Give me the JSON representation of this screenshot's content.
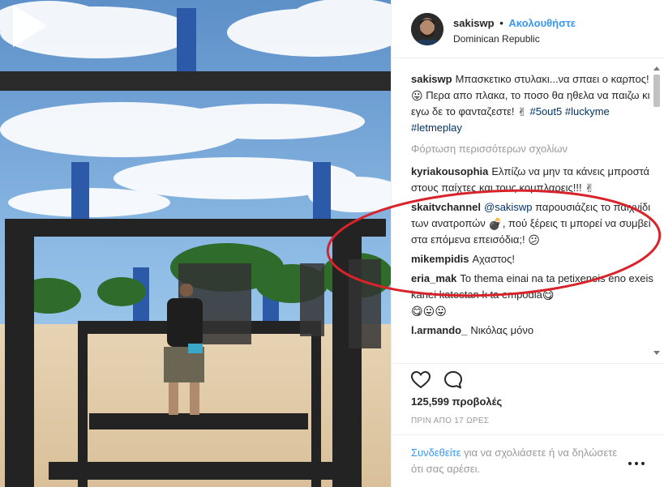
{
  "post": {
    "username": "sakiswp",
    "separator": "•",
    "follow_label": "Ακολουθήστε",
    "location": "Dominican Republic"
  },
  "caption": {
    "username": "sakiswp",
    "text": "Μπασκετικο στυλακι...να σπαει ο καρπος!",
    "text2": "Περα απο πλακα, το ποσο θα ηθελα να παιζω κι εγω δε το φανταζεστε!",
    "hashtags": [
      "#5out5",
      "#luckyme",
      "#letmeplay"
    ],
    "emojis": [
      "😛",
      "✌"
    ]
  },
  "load_more_label": "Φόρτωση περισσότερων σχολίων",
  "comments": [
    {
      "username": "kyriakousophia",
      "text": "Ελπίζω να μην τα κάνεις μπροστά στους παίχτες και τους κομπλαρεις!!!",
      "emoji": "✌"
    },
    {
      "username": "skaitvchannel",
      "mention": "@sakiswp",
      "text": "παρουσιάζεις το παιχνίδι των ανατροπών",
      "emoji": "💣",
      "text2": ", πού ξέρεις τι μπορεί να συμβεί στα επόμενα επεισόδια;!",
      "emoji2": "😕"
    },
    {
      "username": "mikempidis",
      "text": "Αχαστος!"
    },
    {
      "username": "eria_mak",
      "text": "To thema einai na ta petixeneis eno exeis kanei katostan k ta empodia",
      "emoji": "😋",
      "emoji_line": "😋😛😛"
    },
    {
      "username": "l.armando_",
      "text": "Νικόλας μόνο"
    }
  ],
  "views": "125,599 προβολές",
  "timestamp": "ΠΡΙΝ ΑΠΟ 17 ΩΡΕΣ",
  "login": {
    "link": "Συνδεθείτε",
    "text": "για να σχολιάσετε ή να δηλώσετε ότι σας αρέσει."
  },
  "icons": {
    "play": "play-icon",
    "like": "heart-icon",
    "comment": "comment-bubble-icon",
    "more": "more-options-icon"
  },
  "colors": {
    "accent": "#3897f0",
    "hashtag": "#003569",
    "annotation": "#d9232b"
  }
}
